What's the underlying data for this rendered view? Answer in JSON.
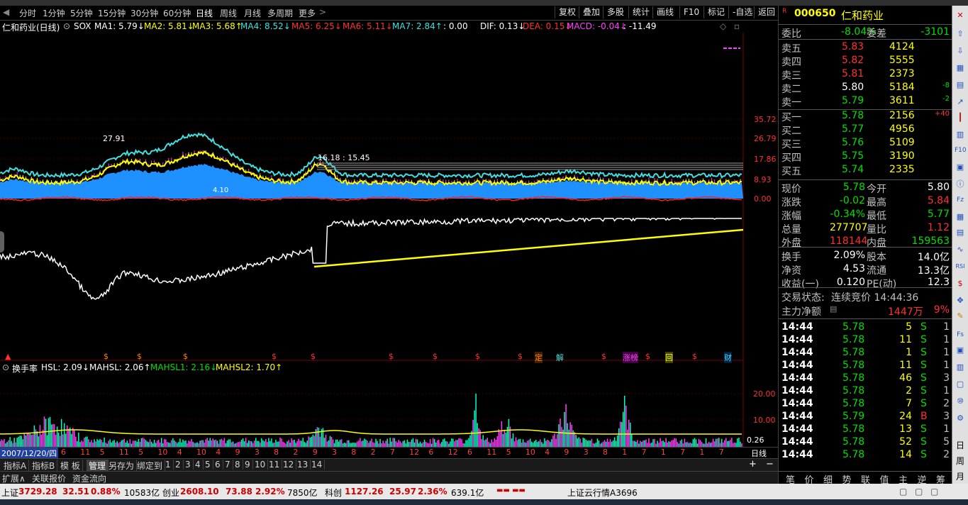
{
  "period_bar": {
    "items": [
      "分时",
      "1分钟",
      "5分钟",
      "15分钟",
      "30分钟",
      "60分钟",
      "日线",
      "周线",
      "月线",
      "多周期",
      "更多"
    ],
    "active": "日线",
    "tools": [
      "复权",
      "叠加",
      "多股",
      "统计",
      "画线",
      "F10",
      "标记",
      "-自选",
      "返回"
    ]
  },
  "title_line": {
    "name": "仁和药业(日线)",
    "indicator": "SOX",
    "ma": [
      {
        "label": "MA1: 5.79",
        "color": "#ffffff",
        "arrow": "↓"
      },
      {
        "label": "MA2: 5.81",
        "color": "#ffff00",
        "arrow": "↓"
      },
      {
        "label": "MA3: 5.68",
        "color": "#ffff00",
        "arrow": "↑"
      },
      {
        "label": "MA4: 8.52",
        "color": "#40e0e0",
        "arrow": "↓"
      },
      {
        "label": "MA5: 6.25",
        "color": "#ff3030",
        "arrow": "↓"
      },
      {
        "label": "MA6: 5.11",
        "color": "#ff3030",
        "arrow": "↓"
      },
      {
        "label": "MA7: 2.84",
        "color": "#40e0e0",
        "arrow": "↑"
      },
      {
        "label": ": 0.00",
        "color": "#ffffff",
        "arrow": ""
      },
      {
        "label": "DIF: 0.13",
        "color": "#ffffff",
        "arrow": "↓"
      },
      {
        "label": "DEA: 0.15",
        "color": "#ff3030",
        "arrow": "↓"
      },
      {
        "label": "MACD: -0.04",
        "color": "#ff40ff",
        "arrow": "↓"
      },
      {
        "label": ": -11.49",
        "color": "#ffffff",
        "arrow": ""
      }
    ]
  },
  "price_axis": [
    "35.72",
    "26.79",
    "17.86",
    "8.93",
    "0.00"
  ],
  "price_annotations": {
    "peak1": "27.91",
    "peak2": "16.18 : 15.45",
    "low1": "4.10"
  },
  "turnover_line": {
    "name": "换手率",
    "items": [
      {
        "label": "HSL: 2.09",
        "color": "#ffffff",
        "arrow": "↓"
      },
      {
        "label": "MAHSL: 2.06",
        "color": "#ffffff",
        "arrow": "↑"
      },
      {
        "label": "MAHSL1: 2.16",
        "color": "#00e000",
        "arrow": "↓"
      },
      {
        "label": "MAHSL2: 1.70",
        "color": "#ffff00",
        "arrow": "↑"
      }
    ]
  },
  "turnover_axis": [
    "20.00",
    "10.00",
    "0.26"
  ],
  "date_bar": {
    "start": "2007/12/20/四",
    "marks": [
      "6",
      "11",
      "5",
      "11",
      "5",
      "10",
      "4",
      "10",
      "4",
      "9",
      "3",
      "8",
      "2",
      "9",
      "3",
      "8",
      "2",
      "7",
      "12",
      "6",
      "12",
      "6",
      "11",
      "5",
      "10",
      "4",
      "9",
      "3",
      "8",
      "1",
      "7",
      "1",
      "7",
      "1",
      "7"
    ],
    "period": "日线"
  },
  "flags": [
    "定",
    "解",
    "涨榜",
    "回",
    "财"
  ],
  "tabs": [
    "指标A",
    "指标B",
    "模 板",
    "管理",
    "另存为",
    "绑定到",
    "1",
    "2",
    "3",
    "4",
    "5",
    "6",
    "7",
    "8",
    "9",
    "10",
    "11",
    "12",
    "13",
    "14"
  ],
  "active_tab": "管理",
  "tabs2": [
    "扩展∧",
    "关联报价",
    "资金流向"
  ],
  "quote": {
    "code": "000650",
    "name": "仁和药业",
    "weibi_label": "委比",
    "weibi": "-8.04%",
    "weicha_label": "委差",
    "weicha": "-3101",
    "asks": [
      {
        "label": "卖五",
        "price": "5.83",
        "vol": "4124",
        "chg": ""
      },
      {
        "label": "卖四",
        "price": "5.82",
        "vol": "5555",
        "chg": ""
      },
      {
        "label": "卖三",
        "price": "5.81",
        "vol": "2373",
        "chg": ""
      },
      {
        "label": "卖二",
        "price": "5.80",
        "vol": "5184",
        "chg": "-8"
      },
      {
        "label": "卖一",
        "price": "5.79",
        "vol": "3611",
        "chg": "-2"
      }
    ],
    "bids": [
      {
        "label": "买一",
        "price": "5.78",
        "vol": "2156",
        "chg": "+40"
      },
      {
        "label": "买二",
        "price": "5.77",
        "vol": "4956",
        "chg": ""
      },
      {
        "label": "买三",
        "price": "5.76",
        "vol": "5109",
        "chg": ""
      },
      {
        "label": "买四",
        "price": "5.75",
        "vol": "3190",
        "chg": ""
      },
      {
        "label": "买五",
        "price": "5.74",
        "vol": "2335",
        "chg": ""
      }
    ],
    "stats": [
      {
        "l1": "现价",
        "v1": "5.78",
        "l2": "今开",
        "v2": "5.80",
        "c1": "#00e000",
        "c2": "#ffffff"
      },
      {
        "l1": "涨跌",
        "v1": "-0.02",
        "l2": "最高",
        "v2": "5.84",
        "c1": "#00e000",
        "c2": "#ff3030"
      },
      {
        "l1": "涨幅",
        "v1": "-0.34%",
        "l2": "最低",
        "v2": "5.77",
        "c1": "#00e000",
        "c2": "#00e000"
      },
      {
        "l1": "总量",
        "v1": "277707",
        "l2": "量比",
        "v2": "1.12",
        "c1": "#ffff00",
        "c2": "#ff3030"
      },
      {
        "l1": "外盘",
        "v1": "118144",
        "l2": "内盘",
        "v2": "159563",
        "c1": "#ff3030",
        "c2": "#00e000"
      }
    ],
    "stats2": [
      {
        "l1": "换手",
        "v1": "2.09%",
        "l2": "股本",
        "v2": "14.0亿"
      },
      {
        "l1": "净资",
        "v1": "4.53",
        "l2": "流通",
        "v2": "13.3亿"
      },
      {
        "l1": "收益(一)",
        "v1": "0.120",
        "l2": "PE(动)",
        "v2": "12.3"
      }
    ],
    "trade_status_label": "交易状态:",
    "trade_status": "连续竞价 14:44:36",
    "main_net_label": "主力净额",
    "main_net": "1447万",
    "main_pct": "9%",
    "ticks": [
      {
        "t": "14:44",
        "p": "5.78",
        "v": "5",
        "s": "S",
        "n": "1"
      },
      {
        "t": "14:44",
        "p": "5.78",
        "v": "11",
        "s": "S",
        "n": "1"
      },
      {
        "t": "14:44",
        "p": "5.78",
        "v": "1",
        "s": "S",
        "n": "1"
      },
      {
        "t": "14:44",
        "p": "5.78",
        "v": "11",
        "s": "S",
        "n": "1"
      },
      {
        "t": "14:44",
        "p": "5.78",
        "v": "46",
        "s": "S",
        "n": "3"
      },
      {
        "t": "14:44",
        "p": "5.78",
        "v": "2",
        "s": "S",
        "n": "1"
      },
      {
        "t": "14:44",
        "p": "5.78",
        "v": "7",
        "s": "S",
        "n": "2"
      },
      {
        "t": "14:44",
        "p": "5.79",
        "v": "24",
        "s": "B",
        "n": "3"
      },
      {
        "t": "14:44",
        "p": "5.78",
        "v": "13",
        "s": "S",
        "n": "1"
      },
      {
        "t": "14:44",
        "p": "5.78",
        "v": "52",
        "s": "S",
        "n": "5"
      },
      {
        "t": "14:44",
        "p": "5.78",
        "v": "14",
        "s": "S",
        "n": "2"
      }
    ],
    "bottom_tabs": [
      "笔",
      "价",
      "细",
      "势",
      "联",
      "值",
      "主",
      "逆",
      "筹"
    ]
  },
  "right_toolbar": [
    "日",
    "周",
    "月"
  ],
  "status": {
    "sh_label": "上证",
    "sh_val": "3729.28",
    "sh_chg": "32.51",
    "sh_pct": "0.88%",
    "sh_amt": "10583亿",
    "cy_label": "创业",
    "cy_val": "2608.10",
    "cy_chg": "73.88",
    "cy_pct": "2.92%",
    "cy_amt": "7850亿",
    "kc_label": "科创",
    "kc_val": "1127.26",
    "kc_chg": "25.97",
    "kc_pct": "2.36%",
    "kc_amt": "639.1亿",
    "cloud": "上证云行情A3696"
  },
  "colors": {
    "up": "#ff3030",
    "down": "#00e000",
    "accent": "#ffff00",
    "cyan": "#40e0e0",
    "blue": "#1e90ff",
    "magenta": "#ff40ff"
  }
}
